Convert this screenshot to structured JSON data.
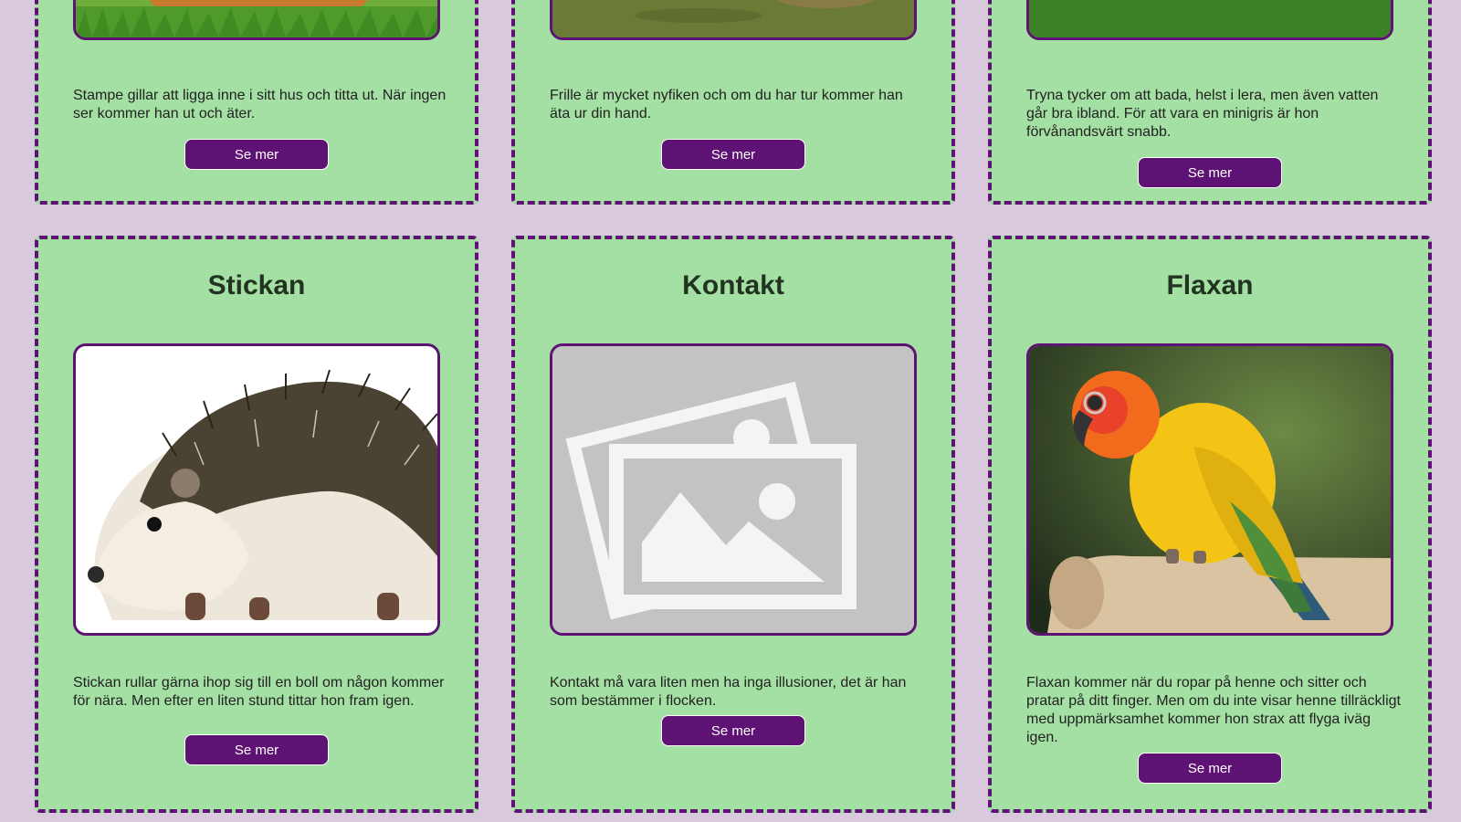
{
  "colors": {
    "page_background": "#d8c9dd",
    "card_background": "#a4dfa3",
    "accent": "#5e1273",
    "placeholder_gray": "#c4c2c4"
  },
  "cards": [
    {
      "description": "Stampe gillar att ligga inne i sitt hus och titta ut. När ingen ser kommer han ut och äter.",
      "button": "Se mer",
      "image_icon": "guinea-pig-photo"
    },
    {
      "description": "Frille är mycket nyfiken och om du har tur kommer han äta ur din hand.",
      "button": "Se mer",
      "image_icon": "animal-on-ground-photo"
    },
    {
      "description": "Tryna tycker om att bada, helst i lera, men även vatten går bra ibland. För att vara en minigris är hon förvånandsvärt snabb.",
      "button": "Se mer",
      "image_icon": "minipig-photo"
    },
    {
      "title": "Stickan",
      "description": "Stickan rullar gärna ihop sig till en boll om någon kommer för nära. Men efter en liten stund tittar hon fram igen.",
      "button": "Se mer",
      "image_icon": "hedgehog-photo"
    },
    {
      "title": "Kontakt",
      "description": "Kontakt må vara liten men ha inga illusioner, det är han som bestämmer i flocken.",
      "button": "Se mer",
      "image_icon": "image-placeholder-icon"
    },
    {
      "title": "Flaxan",
      "description": "Flaxan kommer när du ropar på henne och sitter och pratar på ditt finger. Men om du inte visar henne tillräckligt med uppmärksamhet kommer hon strax att flyga iväg igen.",
      "button": "Se mer",
      "image_icon": "parrot-photo"
    }
  ]
}
